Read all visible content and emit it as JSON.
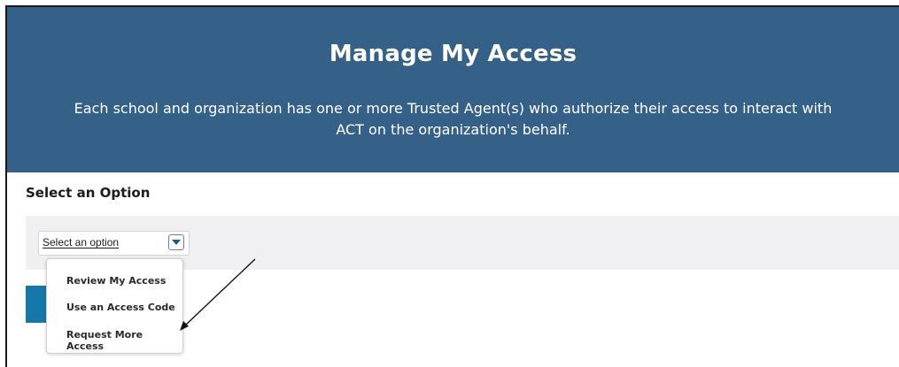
{
  "header": {
    "title": "Manage My Access",
    "subtitle": "Each school and organization has one or more Trusted Agent(s) who authorize their access to interact with ACT on the organization's behalf."
  },
  "section": {
    "title": "Select an Option"
  },
  "select": {
    "value": "Select an option",
    "icon": "chevron-down-icon"
  },
  "menu": {
    "items": [
      {
        "label": "Review My Access"
      },
      {
        "label": "Use an Access Code"
      },
      {
        "label": "Request More Access"
      }
    ]
  },
  "colors": {
    "header_bg": "#356087",
    "band_bg": "#f0f0f2",
    "button_bg": "#1677aa"
  }
}
